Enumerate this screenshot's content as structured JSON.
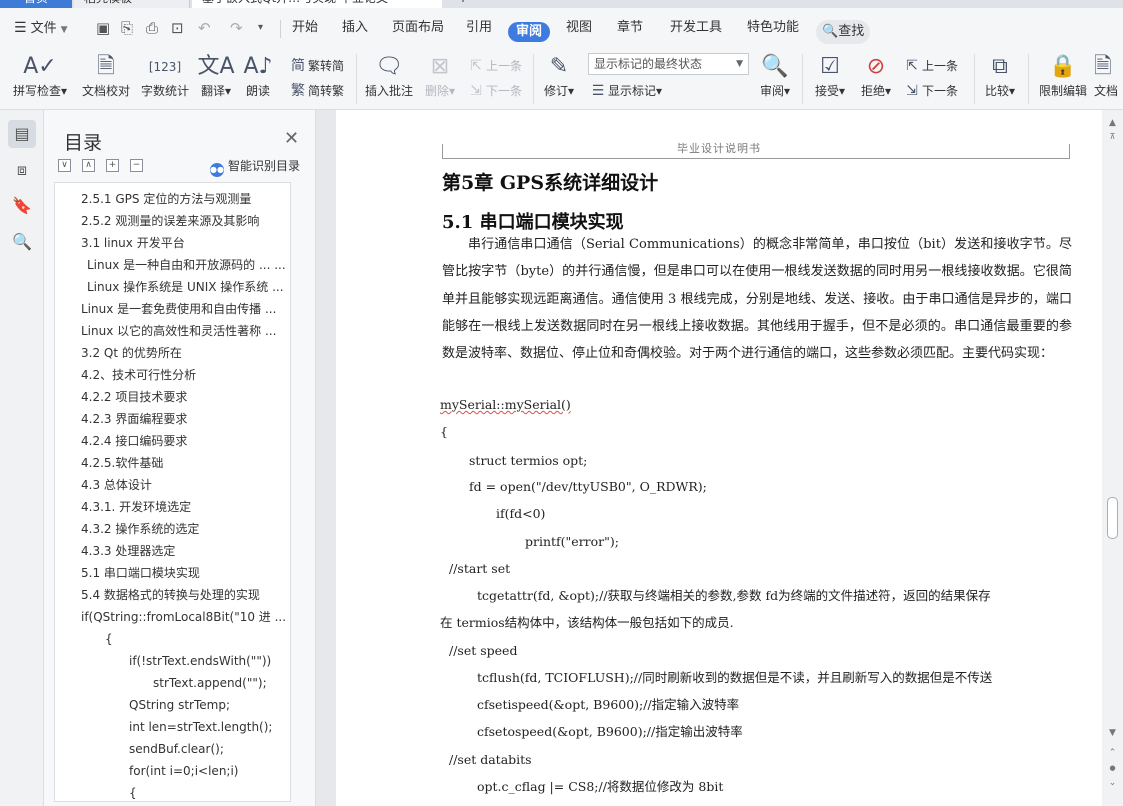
{
  "tabs": {
    "home": "首页",
    "template": "稻壳模板",
    "document": "基于嵌入式Qt开…与实现 毕业论文",
    "plus": "+"
  },
  "menu": {
    "file": "文件",
    "items": [
      "开始",
      "插入",
      "页面布局",
      "引用",
      "审阅",
      "视图",
      "章节",
      "开发工具",
      "特色功能"
    ],
    "active": "审阅",
    "search": "查找"
  },
  "ribbon": {
    "spellcheck": "拼写检查",
    "proofread": "文档校对",
    "wordcount": "字数统计",
    "translate": "翻译",
    "readaloud": "朗读",
    "trad": "繁转简",
    "simp": "简转繁",
    "insert_comment": "插入批注",
    "delete": "删除",
    "prev": "上一条",
    "next": "下一条",
    "revise": "修订",
    "markup_state": "显示标记的最终状态",
    "show_markup": "显示标记",
    "review": "审阅",
    "accept": "接受",
    "reject": "拒绝",
    "prev2": "上一条",
    "next2": "下一条",
    "compare": "比较",
    "restrict": "限制编辑",
    "protect": "文档"
  },
  "toc": {
    "title": "目录",
    "ai": "智能识别目录",
    "items": [
      "2.5.1 GPS 定位的方法与观测量",
      "2.5.2 观测量的误差来源及其影响",
      "3.1 linux 开发平台",
      "Linux 是一种自由和开放源码的 ... ...",
      "Linux 操作系统是 UNIX 操作系统 ...",
      "Linux 是一套免费使用和自由传播 ...",
      "Linux 以它的高效性和灵活性著称 ...",
      "3.2 Qt 的优势所在",
      "4.2、技术可行性分析",
      "4.2.2 项目技术要求",
      "4.2.3 界面编程要求",
      "4.2.4 接口编码要求",
      "4.2.5.软件基础",
      "4.3 总体设计",
      "4.3.1. 开发环境选定",
      "4.3.2 操作系统的选定",
      "4.3.3 处理器选定",
      "5.1 串口端口模块实现",
      "5.4 数据格式的转换与处理的实现",
      "if(QString::fromLocal8Bit(\"10 进 ...",
      "{",
      "if(!strText.endsWith(\"\"))",
      "strText.append(\"\");",
      "QString strTemp;",
      "int len=strText.length();",
      "sendBuf.clear();",
      "for(int i=0;i<len;i)",
      "{"
    ]
  },
  "doc": {
    "header": "毕业设计说明书",
    "chapter": "第5章  GPS系统详细设计",
    "section": "5.1 串口端口模块实现",
    "paragraph": "串行通信串口通信（Serial Communications）的概念非常简单，串口按位（bit）发送和接收字节。尽管比按字节（byte）的并行通信慢，但是串口可以在使用一根线发送数据的同时用另一根线接收数据。它很简单并且能够实现远距离通信。通信使用 3 根线完成，分别是地线、发送、接收。由于串口通信是异步的，端口能够在一根线上发送数据同时在另一根线上接收数据。其他线用于握手，但不是必须的。串口通信最重要的参数是波特率、数据位、停止位和奇偶校验。对于两个进行通信的端口，这些参数必须匹配。主要代码实现：",
    "code": {
      "l1": "mySerial::mySerial()",
      "l2": "{",
      "l3": "struct termios opt;",
      "l4": "fd = open(\"/dev/ttyUSB0\", O_RDWR);",
      "l5": "if(fd<0)",
      "l6": "printf(\"error\");",
      "l7": "//start set",
      "l8": "tcgetattr(fd, &opt);//获取与终端相关的参数,参数 fd为终端的文件描述符，返回的结果保存",
      "l9": "在 termios结构体中，该结构体一般包括如下的成员.",
      "l10": "//set speed",
      "l11": "tcflush(fd, TCIOFLUSH);//同时刷新收到的数据但是不读，并且刷新写入的数据但是不传送",
      "l12": "cfsetispeed(&opt, B9600);//指定输入波特率",
      "l13": "cfsetospeed(&opt, B9600);//指定输出波特率",
      "l14": "//set databits",
      "l15": "opt.c_cflag |= CS8;//将数据位修改为 8bit"
    }
  },
  "colors": {
    "accent": "#3d7be0",
    "spell_underline": "#e04c4c"
  }
}
